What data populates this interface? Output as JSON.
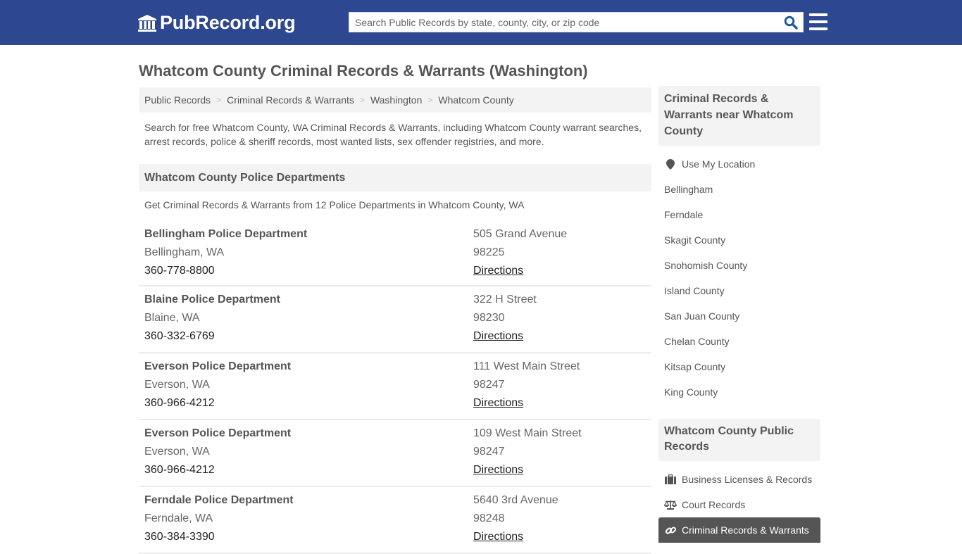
{
  "header": {
    "logo_text": "PubRecord.org",
    "search_placeholder": "Search Public Records by state, county, city, or zip code",
    "search_value": "",
    "colors": {
      "brand": "#2d4890",
      "search_icon": "#1f5aa0"
    }
  },
  "page": {
    "title": "Whatcom County Criminal Records & Warrants (Washington)"
  },
  "breadcrumb": [
    {
      "label": "Public Records"
    },
    {
      "label": "Criminal Records & Warrants"
    },
    {
      "label": "Washington"
    },
    {
      "label": "Whatcom County"
    }
  ],
  "intro": "Search for free Whatcom County, WA Criminal Records & Warrants, including Whatcom County warrant searches, arrest records, police & sheriff records, most wanted lists, sex offender registries, and more.",
  "police_section": {
    "title": "Whatcom County Police Departments",
    "subtitle": "Get Criminal Records & Warrants from 12 Police Departments in Whatcom County, WA",
    "departments": [
      {
        "name": "Bellingham Police Department",
        "city": "Bellingham, WA",
        "phone": "360-778-8800",
        "address": "505 Grand Avenue",
        "zip": "98225",
        "directions": "Directions"
      },
      {
        "name": "Blaine Police Department",
        "city": "Blaine, WA",
        "phone": "360-332-6769",
        "address": "322 H Street",
        "zip": "98230",
        "directions": "Directions"
      },
      {
        "name": "Everson Police Department",
        "city": "Everson, WA",
        "phone": "360-966-4212",
        "address": "111 West Main Street",
        "zip": "98247",
        "directions": "Directions"
      },
      {
        "name": "Everson Police Department",
        "city": "Everson, WA",
        "phone": "360-966-4212",
        "address": "109 West Main Street",
        "zip": "98247",
        "directions": "Directions"
      },
      {
        "name": "Ferndale Police Department",
        "city": "Ferndale, WA",
        "phone": "360-384-3390",
        "address": "5640 3rd Avenue",
        "zip": "98248",
        "directions": "Directions"
      }
    ]
  },
  "sidebar": {
    "nearby": {
      "title": "Criminal Records & Warrants near Whatcom County",
      "use_location": {
        "label": "Use My Location",
        "icon": "map-marker-icon"
      },
      "items": [
        {
          "label": "Bellingham"
        },
        {
          "label": "Ferndale"
        },
        {
          "label": "Skagit County"
        },
        {
          "label": "Snohomish County"
        },
        {
          "label": "Island County"
        },
        {
          "label": "San Juan County"
        },
        {
          "label": "Chelan County"
        },
        {
          "label": "Kitsap County"
        },
        {
          "label": "King County"
        }
      ]
    },
    "public_records": {
      "title": "Whatcom County Public Records",
      "items": [
        {
          "label": "Business Licenses & Records",
          "icon": "briefcase-icon",
          "active": false
        },
        {
          "label": "Court Records",
          "icon": "balance-scale-icon",
          "active": false
        },
        {
          "label": "Criminal Records & Warrants",
          "icon": "link-icon",
          "active": true
        }
      ]
    }
  }
}
